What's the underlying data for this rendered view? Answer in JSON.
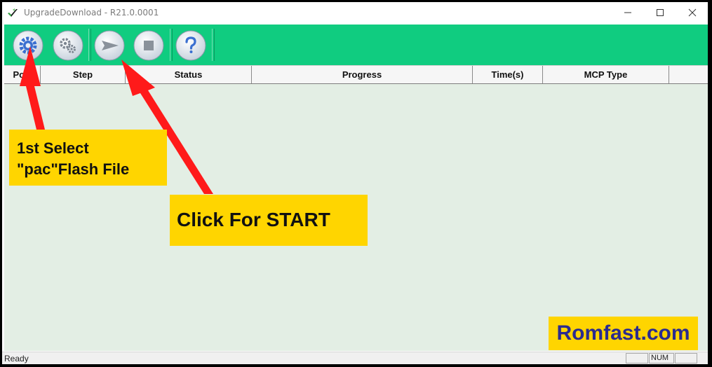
{
  "window": {
    "title": "UpgradeDownload - R21.0.0001",
    "minimize_icon": "minimize-icon",
    "maximize_icon": "maximize-icon",
    "close_icon": "close-icon"
  },
  "toolbar": {
    "buttons": [
      {
        "name": "load-packet-button",
        "icon": "gear-icon"
      },
      {
        "name": "settings-button",
        "icon": "gears-icon"
      },
      {
        "name": "start-download-button",
        "icon": "play-arrow-icon"
      },
      {
        "name": "stop-download-button",
        "icon": "stop-icon"
      },
      {
        "name": "help-button",
        "icon": "question-icon"
      }
    ]
  },
  "table": {
    "columns": [
      "Port",
      "Step",
      "Status",
      "Progress",
      "Time(s)",
      "MCP Type"
    ]
  },
  "annotations": {
    "callout_select_line1": "1st Select",
    "callout_select_line2": "\"pac\"Flash File",
    "callout_start": "Click For START",
    "watermark": "Romfast.com"
  },
  "statusbar": {
    "status": "Ready",
    "num_indicator": "NUM"
  },
  "colors": {
    "toolbar": "#10cc80",
    "grid": "#e3eee4",
    "callout": "#ffd500",
    "arrow": "#ff1a1a",
    "watermark_text": "#2b2b8f"
  }
}
